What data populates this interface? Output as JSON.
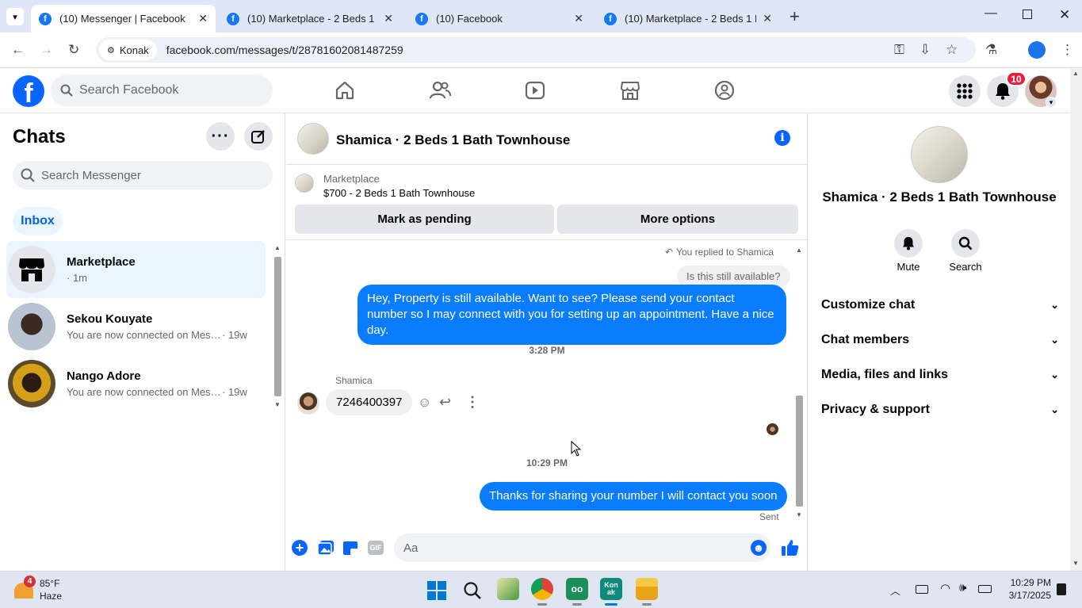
{
  "browser": {
    "tabs": [
      {
        "title": "(10) Messenger | Facebook",
        "active": true
      },
      {
        "title": "(10) Marketplace - 2 Beds 1 Bath",
        "active": false
      },
      {
        "title": "(10) Facebook",
        "active": false
      },
      {
        "title": "(10) Marketplace - 2 Beds 1 Bath",
        "active": false
      }
    ],
    "site_chip": "Konak",
    "url": "facebook.com/messages/t/28781602081487259"
  },
  "fb": {
    "search_placeholder": "Search Facebook",
    "notifications_count": "10"
  },
  "chats": {
    "title": "Chats",
    "search_placeholder": "Search Messenger",
    "inbox_label": "Inbox",
    "items": [
      {
        "name": "Marketplace",
        "preview": "",
        "time": "· 1m"
      },
      {
        "name": "Sekou Kouyate",
        "preview": "You are now connected on Messenger",
        "time": "· 19w"
      },
      {
        "name": "Nango Adore",
        "preview": "You are now connected on Messenger",
        "time": "· 19w"
      }
    ]
  },
  "conversation": {
    "title": "Shamica · 2 Beds 1 Bath Townhouse",
    "marketplace_label": "Marketplace",
    "listing": "$700 - 2 Beds 1 Bath Townhouse",
    "mark_pending": "Mark as pending",
    "more_options": "More options",
    "replied_note": "You replied to Shamica",
    "quoted": "Is this still available?",
    "msg1": "Hey, Property is still available. Want to see? Please send your contact number so I may connect with you for setting up an appointment. Have a nice day.",
    "time1": "3:28 PM",
    "sender": "Shamica",
    "msg2": "7246400397",
    "time2": "10:29 PM",
    "msg3": "Thanks for sharing your number I will contact you soon",
    "status": "Sent",
    "composer_placeholder": "Aa"
  },
  "info": {
    "title": "Shamica · 2 Beds 1 Bath Townhouse",
    "mute": "Mute",
    "search": "Search",
    "sections": [
      "Customize chat",
      "Chat members",
      "Media, files and links",
      "Privacy & support"
    ]
  },
  "taskbar": {
    "weather_temp": "85°F",
    "weather_desc": "Haze",
    "weather_badge": "4",
    "time": "10:29 PM",
    "date": "3/17/2025",
    "app_konak": "Kon ak"
  },
  "colors": {
    "fb_blue": "#0866ff",
    "bubble": "#0a7cff",
    "notif": "#e41e3f"
  }
}
